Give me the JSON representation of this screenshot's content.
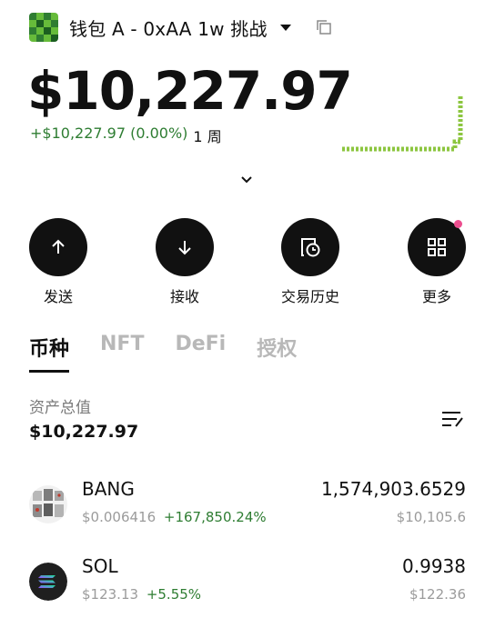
{
  "header": {
    "title": "钱包 A - 0xAA 1w 挑战",
    "avatar_icon": "pixel-avatar-icon",
    "dropdown_icon": "caret-down-icon",
    "copy_icon": "copy-icon"
  },
  "balance": {
    "total": "$10,227.97",
    "change": "+$10,227.97 (0.00%)",
    "period": "1 周"
  },
  "actions": [
    {
      "label": "发送",
      "icon": "arrow-up-icon"
    },
    {
      "label": "接收",
      "icon": "arrow-down-icon"
    },
    {
      "label": "交易历史",
      "icon": "history-icon"
    },
    {
      "label": "更多",
      "icon": "grid-more-icon"
    }
  ],
  "tabs": [
    {
      "label": "币种",
      "active": true
    },
    {
      "label": "NFT",
      "active": false
    },
    {
      "label": "DeFi",
      "active": false
    },
    {
      "label": "授权",
      "active": false
    }
  ],
  "assets": {
    "label": "资产总值",
    "total": "$10,227.97"
  },
  "tokens": [
    {
      "name": "BANG",
      "price": "$0.006416",
      "change": "+167,850.24%",
      "quantity": "1,574,903.6529",
      "value": "$10,105.6"
    },
    {
      "name": "SOL",
      "price": "$123.13",
      "change": "+5.55%",
      "quantity": "0.9938",
      "value": "$122.36"
    }
  ],
  "colors": {
    "positive": "#2e7d32",
    "sparkline": "#8cc63f",
    "accent_dot": "#ec4e8f"
  }
}
